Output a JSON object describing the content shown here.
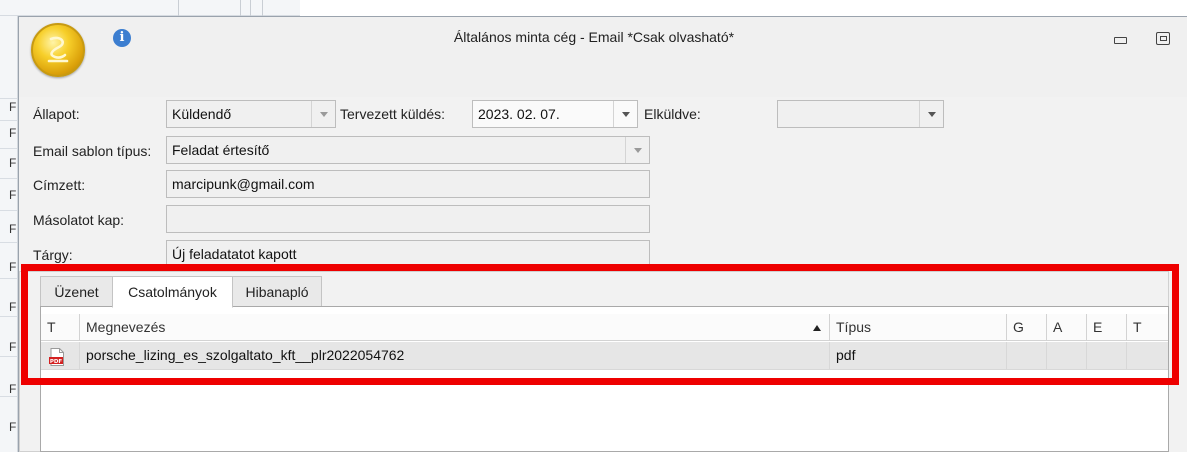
{
  "window": {
    "title": "Általános minta cég - Email *Csak olvasható*"
  },
  "background": {
    "row_letters": [
      "F",
      "F",
      "F",
      "F",
      "F",
      "F",
      "F",
      "F",
      "F",
      "F"
    ]
  },
  "icons": {
    "app_logo": "app-orb-icon",
    "info": "info-icon",
    "minimize": "minimize-icon",
    "maximize": "maximize-icon",
    "pdf": "pdf-file-icon",
    "sort": "sort-ascending-icon"
  },
  "form": {
    "status_label": "Állapot:",
    "status_value": "Küldendő",
    "planned_send_label": "Tervezett küldés:",
    "planned_send_value": "2023. 02. 07.",
    "sent_label": "Elküldve:",
    "sent_value": "",
    "template_type_label": "Email sablon típus:",
    "template_type_value": "Feladat értesítő",
    "recipient_label": "Címzett:",
    "recipient_value": "marcipunk@gmail.com",
    "cc_label": "Másolatot kap:",
    "cc_value": "",
    "subject_label": "Tárgy:",
    "subject_value": "Új feladatatot kapott"
  },
  "tabs": [
    {
      "label": "Üzenet",
      "active": false
    },
    {
      "label": "Csatolmányok",
      "active": true
    },
    {
      "label": "Hibanapló",
      "active": false
    }
  ],
  "attachments": {
    "columns": [
      "T",
      "Megnevezés",
      "Típus",
      "G",
      "A",
      "E",
      "T"
    ],
    "rows": [
      {
        "name": "porsche_lizing_es_szolgaltato_kft__plr2022054762",
        "type": "pdf"
      }
    ]
  },
  "colors": {
    "highlight": "#ee0000",
    "app_orb": "#f7cf2a",
    "info": "#3c7ed0"
  }
}
